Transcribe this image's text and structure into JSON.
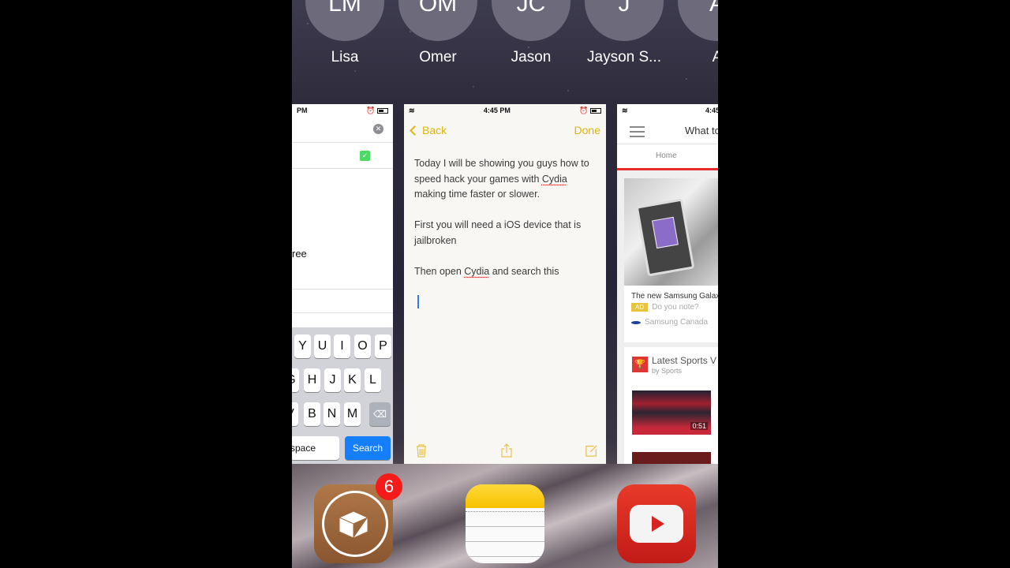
{
  "contacts": [
    {
      "initials": "LM",
      "name": "Lisa"
    },
    {
      "initials": "OM",
      "name": "Omer"
    },
    {
      "initials": "JC",
      "name": "Jason"
    },
    {
      "initials": "J",
      "name": "Jayson S..."
    },
    {
      "initials": "A",
      "name": "A"
    }
  ],
  "cards": {
    "search_app": {
      "status_time": "PM",
      "visible_text": "ree",
      "keyboard": {
        "row1": [
          "Y",
          "U",
          "I",
          "O",
          "P"
        ],
        "row2": [
          "G",
          "H",
          "J",
          "K",
          "L"
        ],
        "row3": [
          "V",
          "B",
          "N",
          "M"
        ],
        "space_label": "space",
        "search_label": "Search"
      }
    },
    "notes": {
      "status_time": "4:45 PM",
      "back_label": "Back",
      "done_label": "Done",
      "paragraphs": [
        "Today I will be showing you guys how to speed hack your games with Cydia making time faster or slower.",
        "First you will need a iOS device that is jailbroken",
        "Then open Cydia and search  this"
      ],
      "toolbar": {
        "delete": "trash-icon",
        "share": "share-icon",
        "compose": "compose-icon"
      }
    },
    "news": {
      "status_time": "4:45",
      "title": "What to",
      "tab_home": "Home",
      "ad": {
        "title": "The new Samsung Galaxy",
        "badge": "AD",
        "tagline": "Do you note?",
        "sponsor": "Samsung Canada"
      },
      "section": {
        "title": "Latest Sports V",
        "by": "by Sports",
        "video_duration": "0:51"
      }
    }
  },
  "dock": {
    "apps": [
      {
        "name": "Cydia",
        "badge": "6"
      },
      {
        "name": "Notes"
      },
      {
        "name": "YouTube"
      }
    ]
  },
  "colors": {
    "notes_accent": "#e0b40e",
    "keyboard_search": "#147efb",
    "news_accent": "#e52d2d",
    "badge_red": "#f51b1b"
  }
}
